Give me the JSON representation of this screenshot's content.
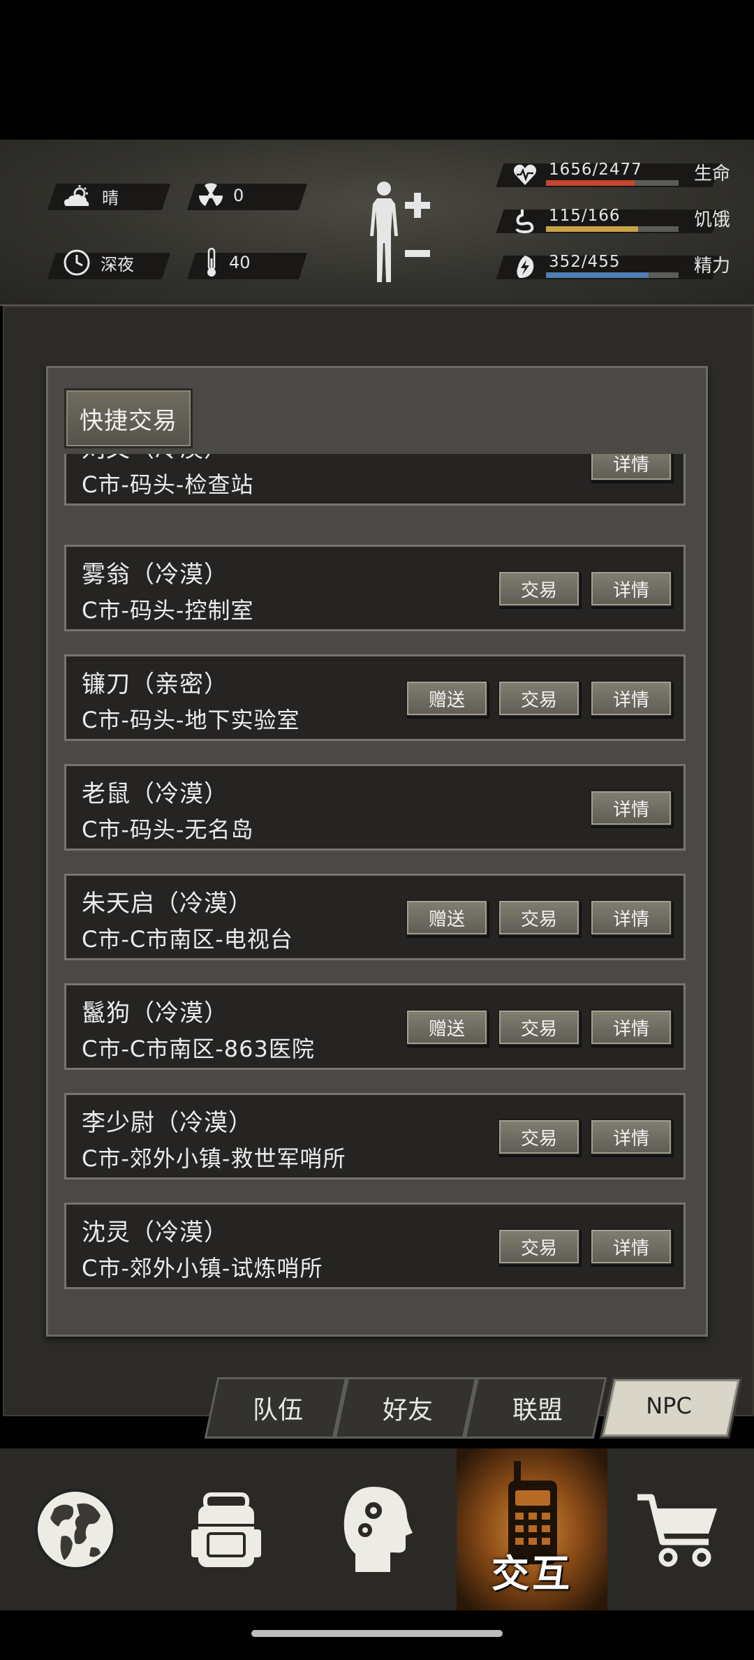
{
  "status": {
    "weather": "晴",
    "radiation": "0",
    "time_of_day": "深夜",
    "temperature": "40",
    "stats": [
      {
        "label": "生命",
        "value": "1656/2477",
        "fraction": 0.669,
        "color": "#c8452f",
        "icon": "heart-icon"
      },
      {
        "label": "饥饿",
        "value": "115/166",
        "fraction": 0.693,
        "color": "#c9a24a",
        "icon": "stomach-icon"
      },
      {
        "label": "精力",
        "value": "352/455",
        "fraction": 0.774,
        "color": "#4f7fb3",
        "icon": "energy-icon"
      }
    ]
  },
  "panel": {
    "quick_trade_label": "快捷交易",
    "npcs": [
      {
        "name": "刘文（冷漠）",
        "location": "C市-码头-检查站",
        "buttons": [
          "详情"
        ]
      },
      {
        "name": "雾翁（冷漠）",
        "location": "C市-码头-控制室",
        "buttons": [
          "交易",
          "详情"
        ]
      },
      {
        "name": "镰刀（亲密）",
        "location": "C市-码头-地下实验室",
        "buttons": [
          "赠送",
          "交易",
          "详情"
        ]
      },
      {
        "name": "老鼠（冷漠）",
        "location": "C市-码头-无名岛",
        "buttons": [
          "详情"
        ]
      },
      {
        "name": "朱天启（冷漠）",
        "location": "C市-C市南区-电视台",
        "buttons": [
          "赠送",
          "交易",
          "详情"
        ]
      },
      {
        "name": "鬣狗（冷漠）",
        "location": "C市-C市南区-863医院",
        "buttons": [
          "赠送",
          "交易",
          "详情"
        ]
      },
      {
        "name": "李少尉（冷漠）",
        "location": "C市-郊外小镇-救世军哨所",
        "buttons": [
          "交易",
          "详情"
        ]
      },
      {
        "name": "沈灵（冷漠）",
        "location": "C市-郊外小镇-试炼哨所",
        "buttons": [
          "交易",
          "详情"
        ]
      }
    ]
  },
  "tabs": [
    {
      "label": "队伍",
      "active": false
    },
    {
      "label": "好友",
      "active": false
    },
    {
      "label": "联盟",
      "active": false
    },
    {
      "label": "NPC",
      "active": true
    }
  ],
  "bottom_nav": {
    "items": [
      {
        "icon": "globe-icon"
      },
      {
        "icon": "backpack-icon"
      },
      {
        "icon": "head-gears-icon"
      },
      {
        "icon": "walkie-talkie-icon",
        "label": "交互",
        "active": true
      },
      {
        "icon": "cart-icon"
      }
    ]
  }
}
